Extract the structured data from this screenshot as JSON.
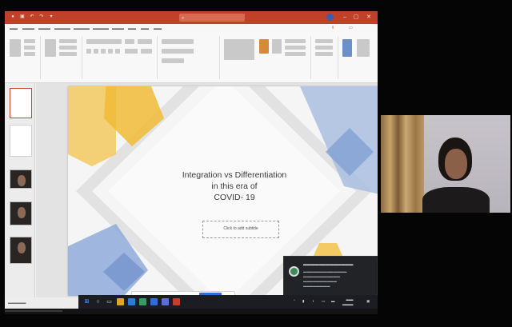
{
  "colors": {
    "ppt_titlebar": "#c1402a",
    "slide_yellow": "#f2c24a",
    "slide_blue": "#6f93cf",
    "taskbar": "#1b1d22",
    "toast_bg": "#222326"
  },
  "titlebar": {
    "doc_title": "",
    "search_placeholder": "",
    "user_name": "",
    "minimize_icon": "minimize-icon",
    "maximize_icon": "maximize-icon",
    "close_icon": "close-icon"
  },
  "slide": {
    "title_lines": [
      "Integration vs Differentiation",
      "in this era of",
      "COVID- 19"
    ],
    "subtitle_placeholder": "Click to add subtitle"
  },
  "thumbnails": [
    {
      "kind": "title-slide",
      "active": true
    },
    {
      "kind": "text-slide",
      "active": false
    },
    {
      "kind": "photo",
      "active": false
    },
    {
      "kind": "photo",
      "active": false
    },
    {
      "kind": "photo",
      "active": false
    }
  ],
  "share_banner": {
    "stop_label": "",
    "message": ""
  },
  "toast": {
    "title": "",
    "body": ""
  },
  "webcam": {
    "participant": ""
  }
}
